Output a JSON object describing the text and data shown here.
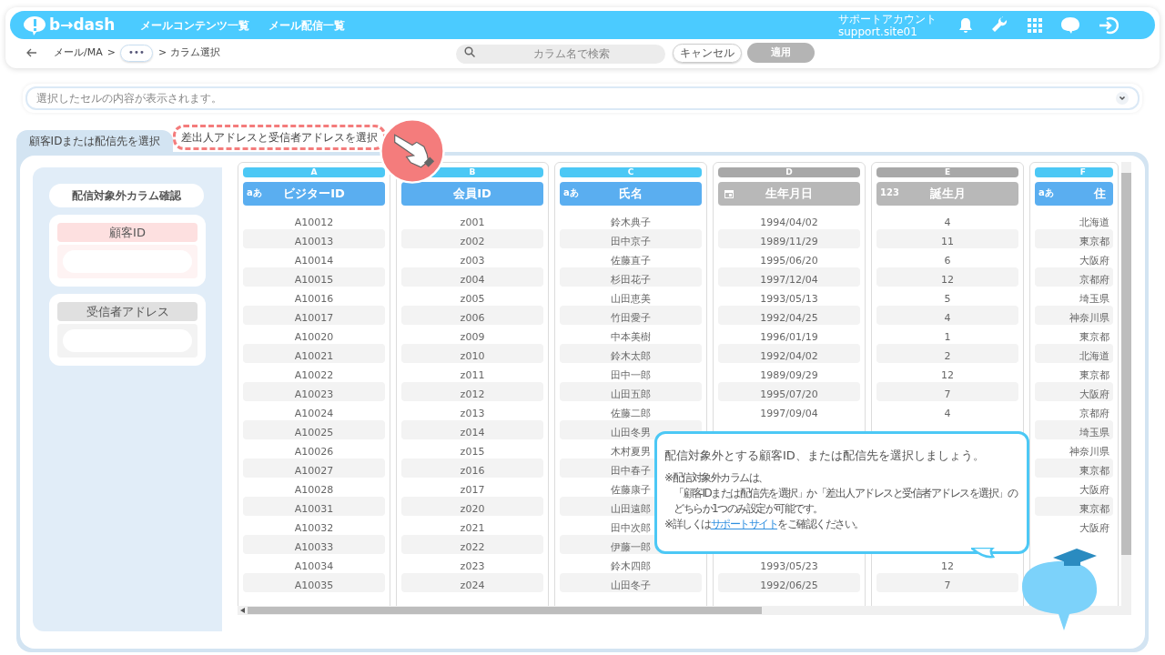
{
  "header": {
    "logo": "b→dash",
    "nav": [
      "メールコンテンツ一覧",
      "メール配信一覧"
    ],
    "account": {
      "name": "サポートアカウント",
      "id": "support.site01"
    }
  },
  "toolbar": {
    "breadcrumb": [
      "メール/MA",
      ">",
      "•••",
      "> カラム選択"
    ],
    "search": {
      "placeholder": "カラム名で検索"
    },
    "cancel": {
      "label": "キャンセル",
      "disabled": false
    },
    "apply": {
      "label": "適用",
      "disabled": true
    }
  },
  "cell_viewer": {
    "placeholder": "選択したセルの内容が表示されます。"
  },
  "tabs": [
    {
      "label": "顧客IDまたは配信先を選択",
      "selected": true,
      "highlighted": false
    },
    {
      "label": "差出人アドレスと受信者アドレスを選択",
      "selected": false,
      "highlighted": true
    }
  ],
  "excluded_panel": {
    "title": "配信対象外カラム確認",
    "groups": [
      {
        "label": "顧客ID",
        "color": "#fde0e0"
      },
      {
        "label": "受信者アドレス",
        "color": "#e0e0e0"
      }
    ]
  },
  "columns": [
    {
      "letter": "A",
      "name": "ビジターID",
      "kind": "text",
      "type_label": "aあ",
      "enabled": true,
      "cells": [
        "A10012",
        "A10013",
        "A10014",
        "A10015",
        "A10016",
        "A10017",
        "A10020",
        "A10021",
        "A10022",
        "A10023",
        "A10024",
        "A10025",
        "A10026",
        "A10027",
        "A10028",
        "A10031",
        "A10032",
        "A10033",
        "A10034",
        "A10035"
      ]
    },
    {
      "letter": "B",
      "name": "会員ID",
      "kind": "plain",
      "enabled": true,
      "cells": [
        "z001",
        "z002",
        "z003",
        "z004",
        "z005",
        "z006",
        "z009",
        "z010",
        "z011",
        "z012",
        "z013",
        "z014",
        "z015",
        "z016",
        "z017",
        "z020",
        "z021",
        "z022",
        "z023",
        "z024"
      ]
    },
    {
      "letter": "C",
      "name": "氏名",
      "kind": "text",
      "type_label": "aあ",
      "enabled": true,
      "cells": [
        "鈴木典子",
        "田中京子",
        "佐藤直子",
        "杉田花子",
        "山田恵美",
        "竹田愛子",
        "中本美樹",
        "鈴木太郎",
        "田中一郎",
        "山田五郎",
        "佐藤二郎",
        "山田冬男",
        "木村夏男",
        "田中春子",
        "佐藤康子",
        "山田遠郎",
        "田中次郎",
        "伊藤一郎",
        "鈴木四郎",
        "山田冬子"
      ]
    },
    {
      "letter": "D",
      "name": "生年月日",
      "kind": "date",
      "enabled": false,
      "cells": [
        "1994/04/02",
        "1989/11/29",
        "1995/06/20",
        "1997/12/04",
        "1993/05/13",
        "1992/04/25",
        "1996/01/19",
        "1992/04/02",
        "1989/09/29",
        "1995/07/20",
        "1997/09/04",
        null,
        null,
        null,
        null,
        null,
        null,
        null,
        "1993/05/23",
        "1992/06/25"
      ]
    },
    {
      "letter": "E",
      "name": "誕生月",
      "kind": "number",
      "type_label": "123",
      "enabled": false,
      "cells": [
        "4",
        "11",
        "6",
        "12",
        "5",
        "4",
        "1",
        "2",
        "12",
        "7",
        "4",
        null,
        null,
        null,
        null,
        null,
        null,
        null,
        "12",
        "7"
      ]
    },
    {
      "letter": "F",
      "name": "住",
      "kind": "text",
      "type_label": "aあ",
      "enabled": true,
      "cells": [
        "北海道",
        "東京都",
        "大阪府",
        "京都府",
        "埼玉県",
        "神奈川県",
        "東京都",
        "北海道",
        "東京都",
        "大阪府",
        "京都府",
        "埼玉県",
        "神奈川県",
        "東京都",
        "大阪府",
        "東京都",
        "大阪府"
      ]
    }
  ],
  "guide": {
    "title": "配信対象外とする顧客ID、または配信先を選択しましょう。",
    "notes": [
      "※配信対象外カラムは、",
      "「顧客IDまたは配信先を選択」か「差出人アドレスと受信者アドレスを選択」の",
      "どちらか1つのみ設定が可能です。"
    ],
    "more": {
      "before": "※詳しくは",
      "link": "サポートサイト",
      "after": "をご確認ください。"
    }
  }
}
